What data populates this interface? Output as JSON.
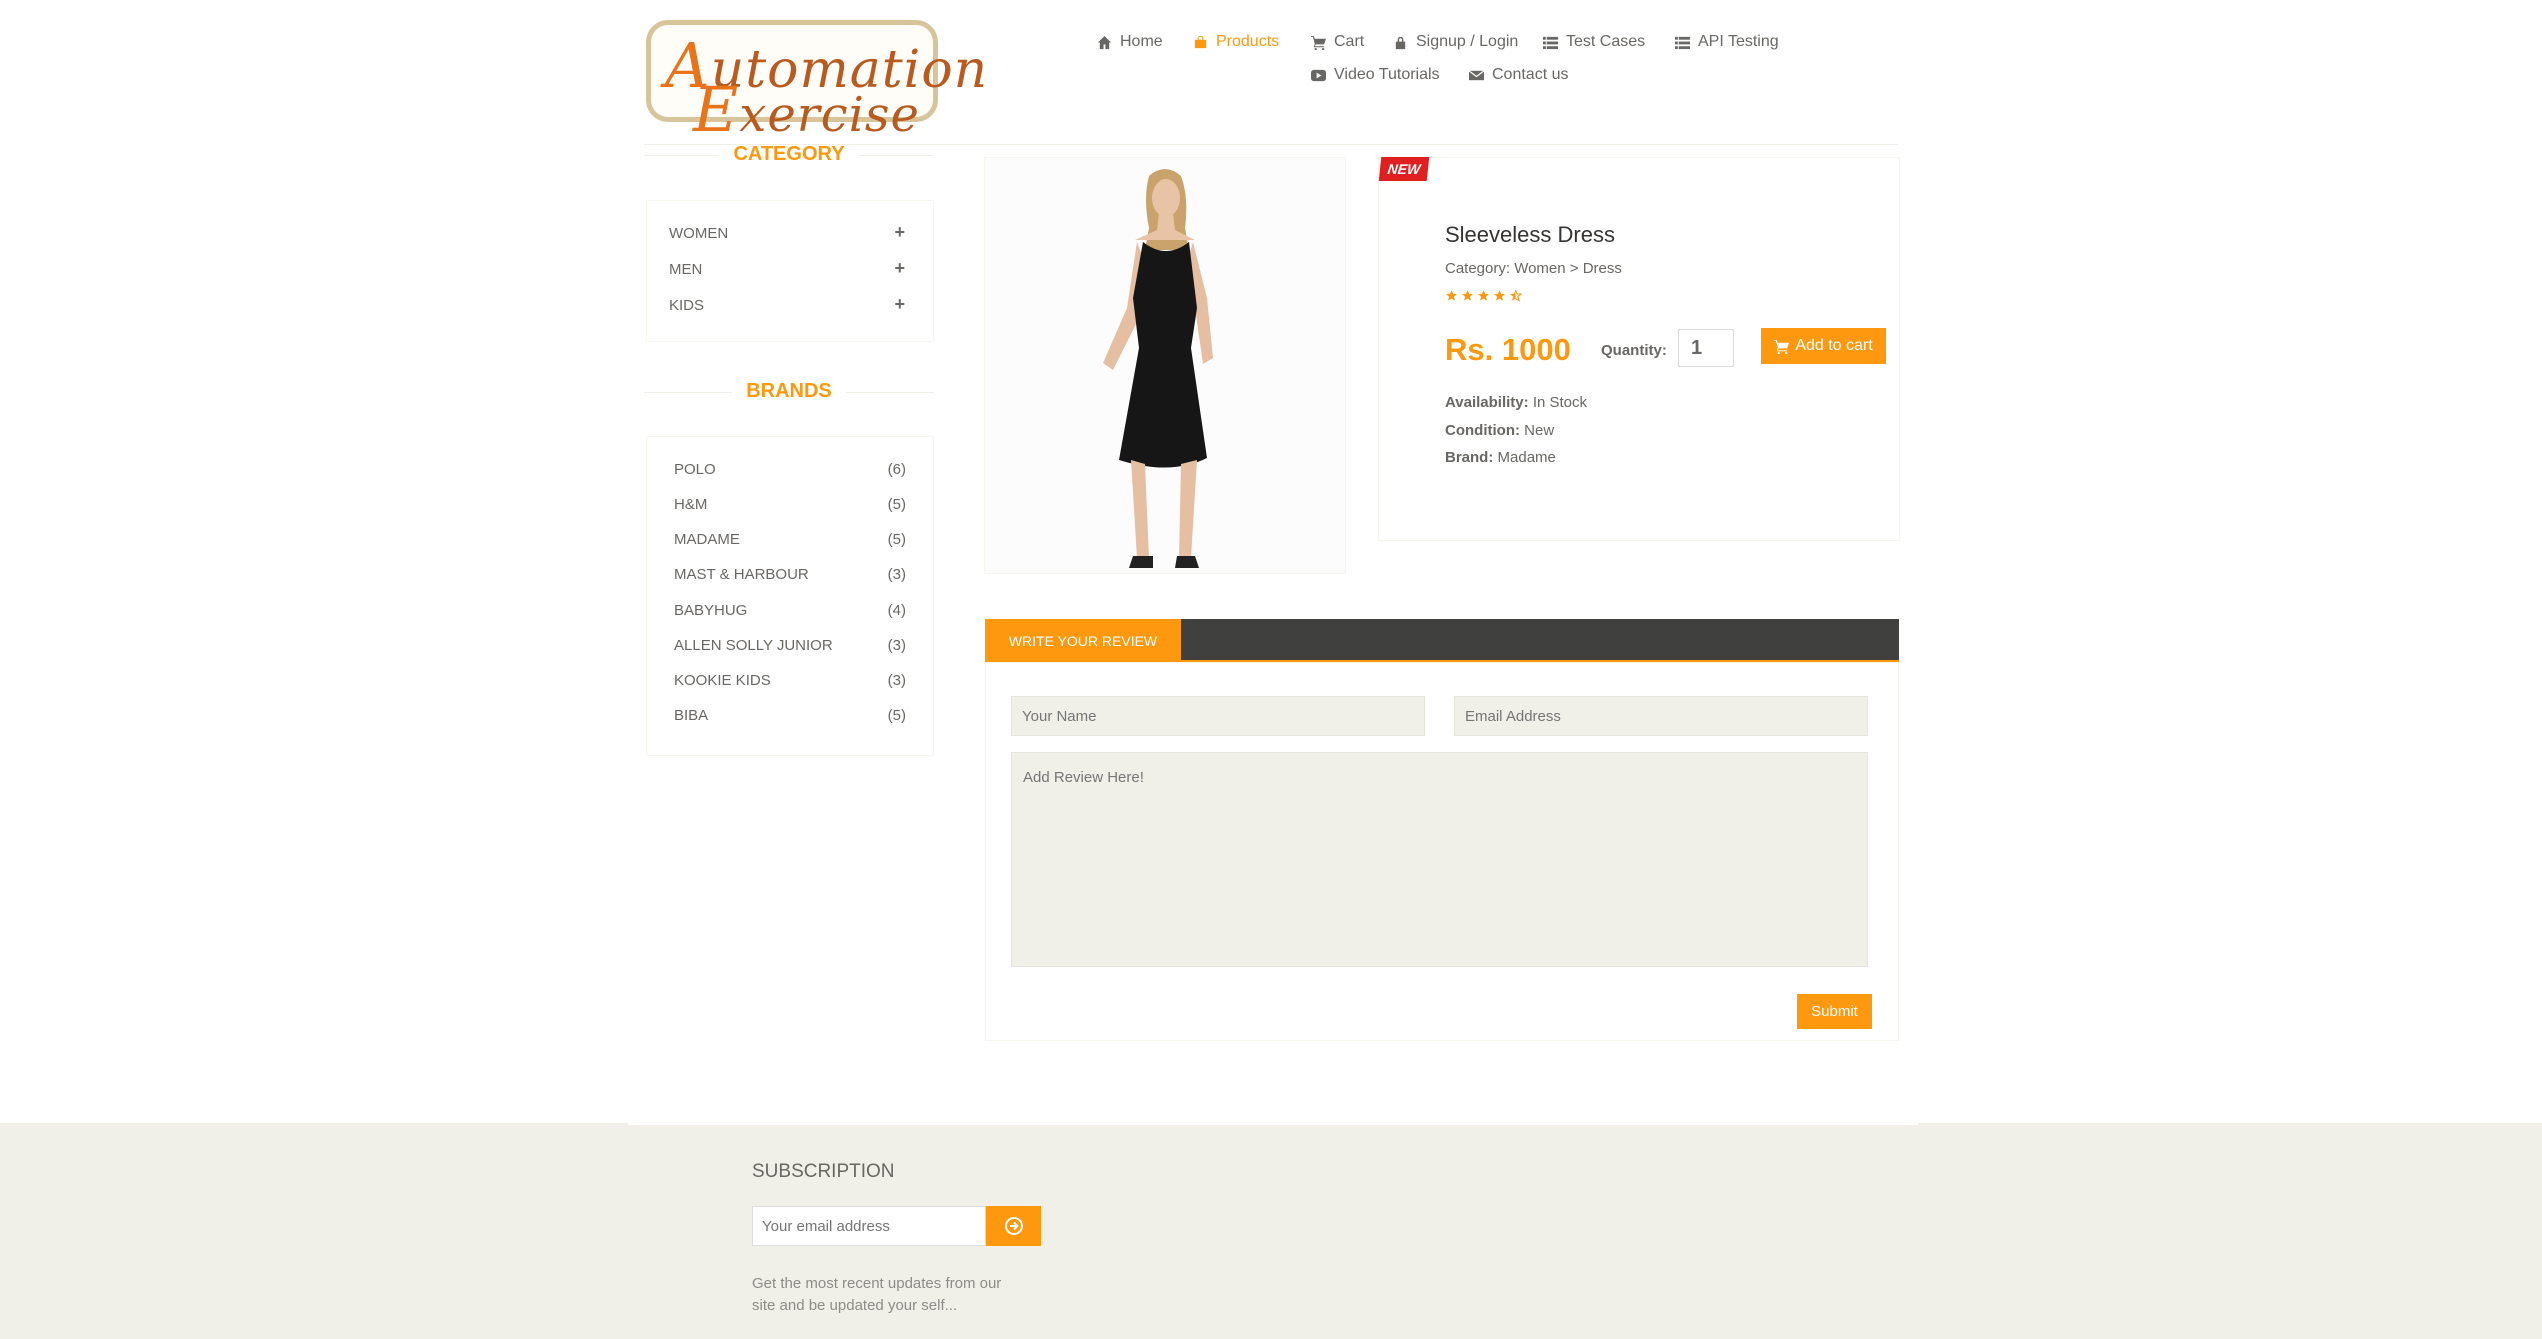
{
  "logo": {
    "line1_cap": "A",
    "line1_rest": "utomation",
    "line2_cap": "E",
    "line2_rest": "xercise"
  },
  "nav": [
    {
      "label": "Home",
      "icon": "home-icon"
    },
    {
      "label": "Products",
      "icon": "shopping-bag-icon",
      "active": true
    },
    {
      "label": "Cart",
      "icon": "cart-icon"
    },
    {
      "label": "Signup / Login",
      "icon": "lock-icon"
    },
    {
      "label": "Test Cases",
      "icon": "list-icon"
    },
    {
      "label": "API Testing",
      "icon": "list-icon"
    },
    {
      "label": "Video Tutorials",
      "icon": "youtube-play-icon"
    },
    {
      "label": "Contact us",
      "icon": "envelope-icon"
    }
  ],
  "sidebar": {
    "category_title": "CATEGORY",
    "categories": [
      "WOMEN",
      "MEN",
      "KIDS"
    ],
    "brands_title": "BRANDS",
    "brands": [
      {
        "name": "POLO",
        "count": "(6)"
      },
      {
        "name": "H&M",
        "count": "(5)"
      },
      {
        "name": "MADAME",
        "count": "(5)"
      },
      {
        "name": "MAST & HARBOUR",
        "count": "(3)"
      },
      {
        "name": "BABYHUG",
        "count": "(4)"
      },
      {
        "name": "ALLEN SOLLY JUNIOR",
        "count": "(3)"
      },
      {
        "name": "KOOKIE KIDS",
        "count": "(3)"
      },
      {
        "name": "BIBA",
        "count": "(5)"
      }
    ]
  },
  "product": {
    "badge": "NEW",
    "name": "Sleeveless Dress",
    "category": "Category: Women > Dress",
    "rating": 4.5,
    "price": "Rs. 1000",
    "quantity_label": "Quantity:",
    "quantity_value": "1",
    "add_to_cart": "Add to cart",
    "availability_label": "Availability:",
    "availability": "In Stock",
    "condition_label": "Condition:",
    "condition": "New",
    "brand_label": "Brand:",
    "brand": "Madame"
  },
  "review": {
    "tab_label": "WRITE YOUR REVIEW",
    "name_placeholder": "Your Name",
    "email_placeholder": "Email Address",
    "review_placeholder": "Add Review Here!",
    "submit_label": "Submit"
  },
  "footer": {
    "subscription_title": "SUBSCRIPTION",
    "email_placeholder": "Your email address",
    "note": "Get the most recent updates from our site and be updated your self..."
  },
  "colors": {
    "accent": "#fe980f",
    "text": "#696763",
    "tabbar": "#40403e",
    "footer_bg": "#f0f0e9",
    "badge": "#e02020"
  }
}
